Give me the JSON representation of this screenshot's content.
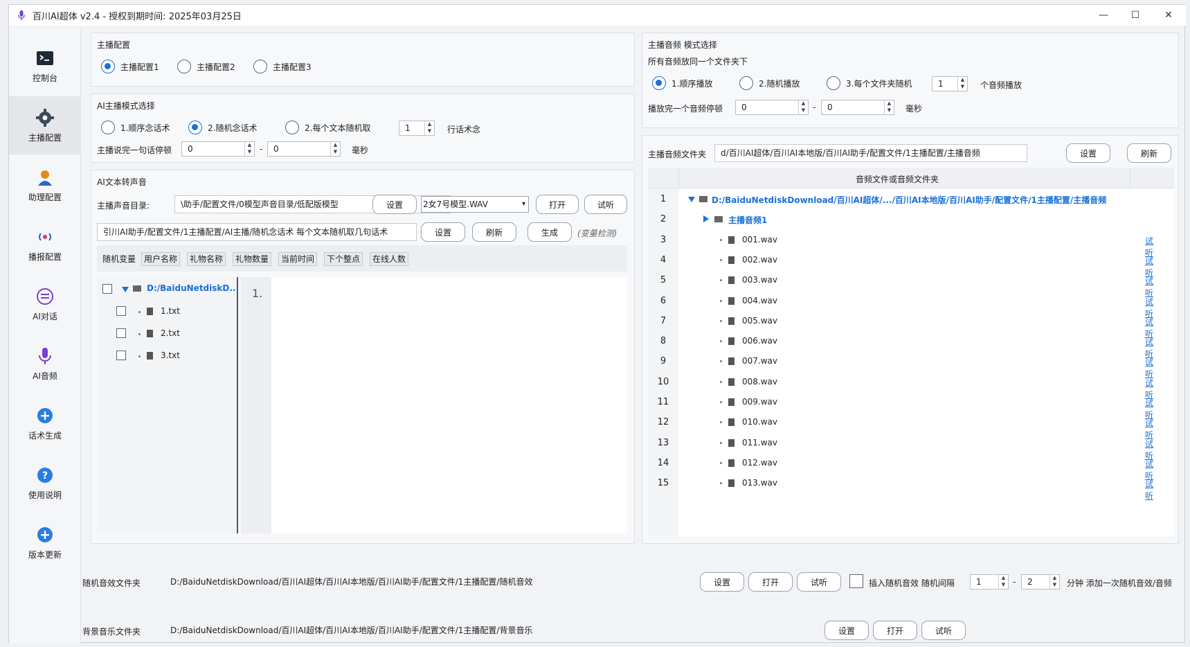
{
  "window": {
    "title": "百川AI超体 v2.4 - 授权到期时间: 2025年03月25日",
    "minimize": "—",
    "maximize": "☐",
    "close": "✕"
  },
  "sidebar": {
    "items": [
      {
        "label": "控制台"
      },
      {
        "label": "主播配置"
      },
      {
        "label": "助理配置"
      },
      {
        "label": "播报配置"
      },
      {
        "label": "AI对话"
      },
      {
        "label": "AI音频"
      },
      {
        "label": "话术生成"
      },
      {
        "label": "使用说明"
      },
      {
        "label": "版本更新"
      }
    ]
  },
  "anchor_config": {
    "title": "主播配置",
    "options": [
      "主播配置1",
      "主播配置2",
      "主播配置3"
    ]
  },
  "ai_mode": {
    "title": "AI主播模式选择",
    "options": [
      "1.顺序念话术",
      "2.随机念话术",
      "2.每个文本随机取"
    ],
    "count": "1",
    "count_suffix": "行话术念",
    "pause_label": "主播说完一句话停顿",
    "pause_from": "0",
    "dash": "-",
    "pause_to": "0",
    "unit": "毫秒"
  },
  "tts": {
    "title": "AI文本转声音",
    "voice_dir_label": "主播声音目录:",
    "voice_dir_value": "\\助手/配置文件/0模型声音目录/低配版模型",
    "set_label": "设置",
    "model_value": "2女7号模型.WAV",
    "open_label": "打开",
    "listen_label": "试听",
    "script_path": "引川AI助手/配置文件/1主播配置/AI主播/随机念话术 每个文本随机取几句话术",
    "set2_label": "设置",
    "refresh_label": "刷新",
    "generate_label": "生成",
    "var_detect": "(变量检测)",
    "variables": [
      "随机变量",
      "用户名称",
      "礼物名称",
      "礼物数量",
      "当前时间",
      "下个整点",
      "在线人数"
    ],
    "tree_root": "D:/BaiduNetdiskD...",
    "tree_files": [
      "1.txt",
      "2.txt",
      "3.txt"
    ],
    "line_number": "1."
  },
  "audio_mode": {
    "title": "主播音频 模式选择",
    "subtitle": "所有音频放同一个文件夹下",
    "options": [
      "1.顺序播放",
      "2.随机播放",
      "3.每个文件夹随机"
    ],
    "count": "1",
    "count_suffix": "个音频播放",
    "pause_label": "播放完一个音频停顿",
    "pause_from": "0",
    "dash": "-",
    "pause_to": "0",
    "unit": "毫秒"
  },
  "audio_folder": {
    "label": "主播音频文件夹",
    "path": "d/百川AI超体/百川AI本地版/百川AI助手/配置文件/1主播配置/主播音频",
    "set_label": "设置",
    "refresh_label": "刷新",
    "column_header": "音频文件或音频文件夹",
    "root_path": "D:/BaiduNetdiskDownload/百川AI超体/.../百川AI本地版/百川AI助手/配置文件/1主播配置/主播音频",
    "subfolder": "主播音频1",
    "rows": [
      {
        "num": "1"
      },
      {
        "num": "2"
      },
      {
        "num": "3",
        "file": "001.wav"
      },
      {
        "num": "4",
        "file": "002.wav"
      },
      {
        "num": "5",
        "file": "003.wav"
      },
      {
        "num": "6",
        "file": "004.wav"
      },
      {
        "num": "7",
        "file": "005.wav"
      },
      {
        "num": "8",
        "file": "006.wav"
      },
      {
        "num": "9",
        "file": "007.wav"
      },
      {
        "num": "10",
        "file": "008.wav"
      },
      {
        "num": "11",
        "file": "009.wav"
      },
      {
        "num": "12",
        "file": "010.wav"
      },
      {
        "num": "13",
        "file": "011.wav"
      },
      {
        "num": "14",
        "file": "012.wav"
      },
      {
        "num": "15",
        "file": "013.wav"
      }
    ],
    "listen_label": "试听"
  },
  "random_sfx": {
    "label": "随机音效文件夹",
    "path": "D:/BaiduNetdiskDownload/百川AI超体/百川AI本地版/百川AI助手/配置文件/1主播配置/随机音效",
    "set_label": "设置",
    "open_label": "打开",
    "listen_label": "试听",
    "insert_label": "插入随机音效 随机间隔",
    "from": "1",
    "dash": "-",
    "to": "2",
    "suffix": "分钟 添加一次随机音效/音频"
  },
  "bgm": {
    "label": "背景音乐文件夹",
    "path": "D:/BaiduNetdiskDownload/百川AI超体/百川AI本地版/百川AI助手/配置文件/1主播配置/背景音乐",
    "set_label": "设置",
    "open_label": "打开",
    "listen_label": "试听"
  },
  "colors": {
    "accent": "#1b6fd8",
    "link": "#1b6fd8"
  }
}
